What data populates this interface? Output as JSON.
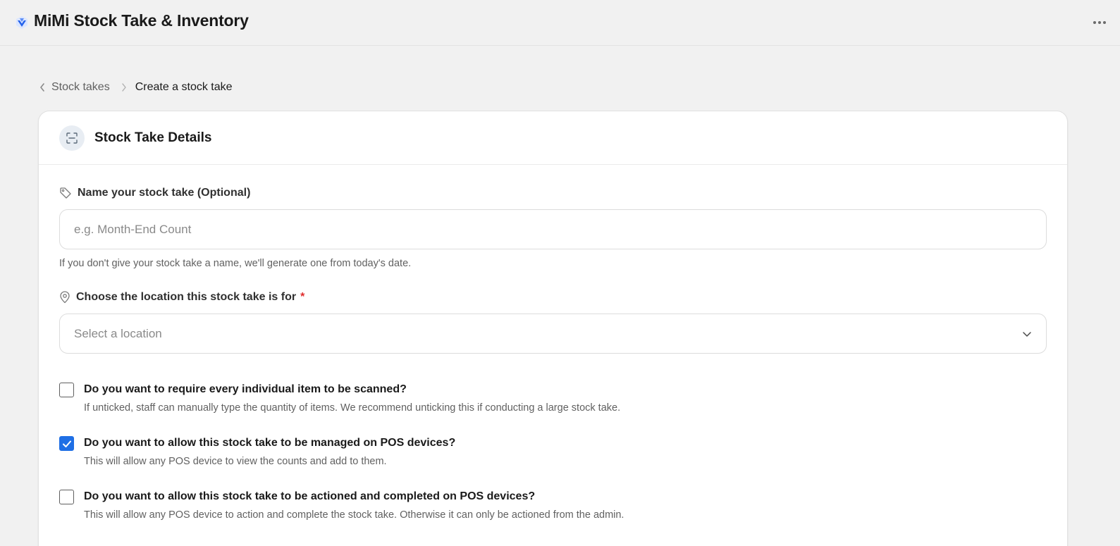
{
  "header": {
    "title": "MiMi Stock Take & Inventory",
    "accent_color": "#2563eb"
  },
  "breadcrumb": {
    "parent": "Stock takes",
    "current": "Create a stock take"
  },
  "card": {
    "title": "Stock Take Details",
    "name_field": {
      "label": "Name your stock take (Optional)",
      "placeholder": "e.g. Month-End Count",
      "value": "",
      "help": "If you don't give your stock take a name, we'll generate one from today's date."
    },
    "location_field": {
      "label": "Choose the location this stock take is for",
      "required_mark": "*",
      "placeholder": "Select a location"
    },
    "options": [
      {
        "title": "Do you want to require every individual item to be scanned?",
        "description": "If unticked, staff can manually type the quantity of items. We recommend unticking this if conducting a large stock take.",
        "checked": false
      },
      {
        "title": "Do you want to allow this stock take to be managed on POS devices?",
        "description": "This will allow any POS device to view the counts and add to them.",
        "checked": true
      },
      {
        "title": "Do you want to allow this stock take to be actioned and completed on POS devices?",
        "description": "This will allow any POS device to action and complete the stock take. Otherwise it can only be actioned from the admin.",
        "checked": false
      }
    ]
  },
  "icons": {
    "logo": "mimi-logo-icon",
    "more": "more-horizontal-icon",
    "back": "chevron-left-icon",
    "separator": "chevron-right-icon",
    "card": "scan-icon",
    "tag": "tag-icon",
    "location": "map-pin-icon",
    "select": "chevron-down-icon",
    "check": "checkmark-icon"
  },
  "colors": {
    "checkbox_checked": "#1f6fe5",
    "required": "#e02d2d"
  }
}
